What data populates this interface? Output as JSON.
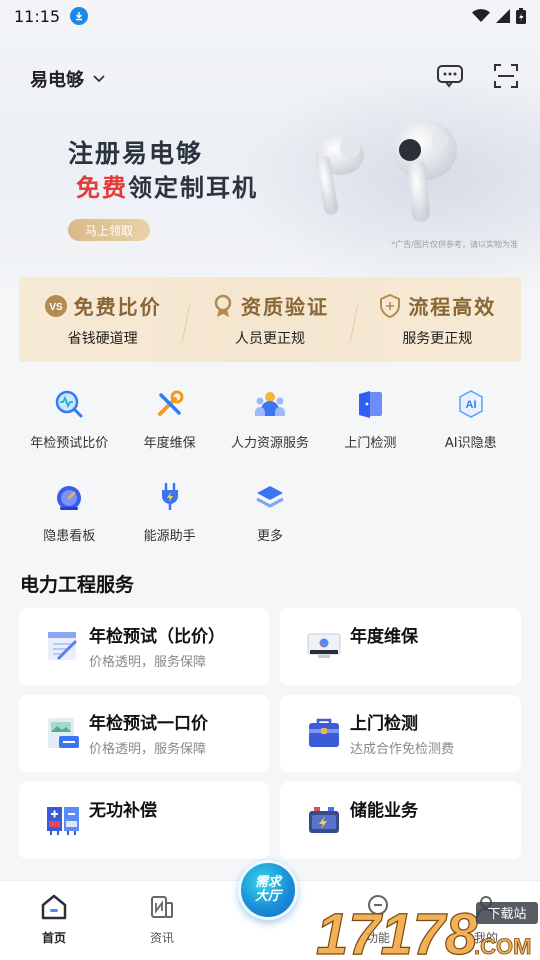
{
  "status_bar": {
    "time": "11:15"
  },
  "header": {
    "app_name": "易电够"
  },
  "banner": {
    "line1": "注册易电够",
    "line2_highlight": "免费",
    "line2_rest": "领定制耳机",
    "cta": "马上领取",
    "ad_note": "*广告/图片仅供参考，请以实物为准"
  },
  "features": [
    {
      "icon": "vs-badge-icon",
      "title": "免费比价",
      "sub": "省钱硬道理"
    },
    {
      "icon": "award-icon",
      "title": "资质验证",
      "sub": "人员更正规"
    },
    {
      "icon": "shield-icon",
      "title": "流程高效",
      "sub": "服务更正规"
    }
  ],
  "quick_actions": [
    {
      "icon": "magnifier-pulse-icon",
      "label": "年检预试比价"
    },
    {
      "icon": "wrench-screwdriver-icon",
      "label": "年度维保"
    },
    {
      "icon": "people-icon",
      "label": "人力资源服务"
    },
    {
      "icon": "door-icon",
      "label": "上门检测"
    },
    {
      "icon": "ai-icon",
      "label": "AI识隐患"
    },
    {
      "icon": "gauge-icon",
      "label": "隐患看板"
    },
    {
      "icon": "plug-icon",
      "label": "能源助手"
    },
    {
      "icon": "layers-icon",
      "label": "更多"
    }
  ],
  "section": {
    "title": "电力工程服务"
  },
  "services": [
    {
      "icon": "calendar-icon",
      "title": "年检预试（比价）",
      "sub": "价格透明，服务保障"
    },
    {
      "icon": "monitor-icon",
      "title": "年度维保",
      "sub": ""
    },
    {
      "icon": "document-image-icon",
      "title": "年检预试一口价",
      "sub": "价格透明，服务保障"
    },
    {
      "icon": "toolbox-icon",
      "title": "上门检测",
      "sub": "达成合作免检测费"
    },
    {
      "icon": "compensator-icon",
      "title": "无功补偿",
      "sub": ""
    },
    {
      "icon": "battery-icon",
      "title": "储能业务",
      "sub": ""
    }
  ],
  "bottom_nav": {
    "items": [
      {
        "icon": "home-icon",
        "label": "首页",
        "active": true
      },
      {
        "icon": "news-icon",
        "label": "资讯",
        "active": false
      },
      {
        "icon": "function-icon",
        "label": "功能",
        "active": false
      },
      {
        "icon": "user-icon",
        "label": "我的",
        "active": false
      }
    ],
    "center_line1": "需求",
    "center_line2": "大厅"
  },
  "watermark": {
    "number": "17178",
    "suffix": ".COM",
    "tag": "下载站"
  },
  "colors": {
    "accent_blue": "#1b8fd8",
    "gold": "#8a6637",
    "red": "#e53935"
  }
}
